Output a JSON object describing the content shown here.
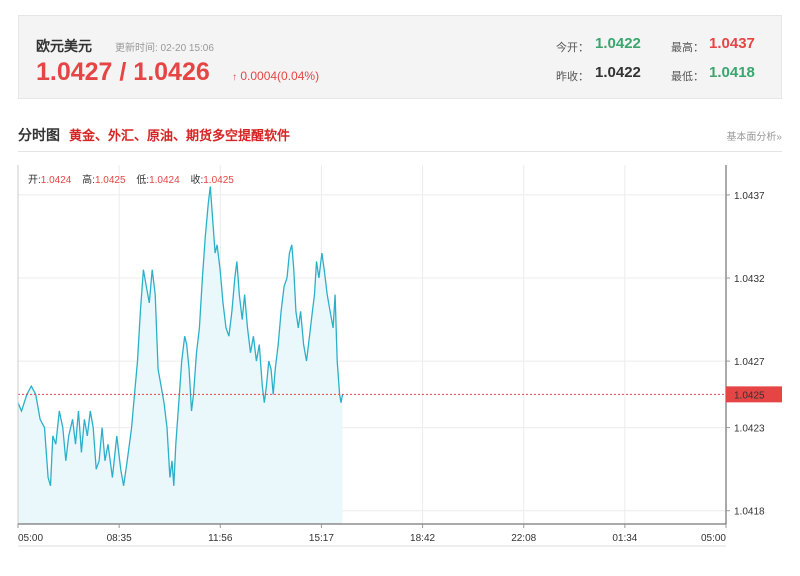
{
  "quote": {
    "name": "欧元美元",
    "update_label": "更新时间: 02-20 15:06",
    "price": "1.0427 / 1.0426",
    "change_arrow": "↑",
    "change": "0.0004(0.04%)",
    "open_label": "今开：",
    "open_value": "1.0422",
    "high_label": "最高：",
    "high_value": "1.0437",
    "prev_close_label": "昨收：",
    "prev_close_value": "1.0422",
    "low_label": "最低：",
    "low_value": "1.0418"
  },
  "tabs": {
    "title": "分时图",
    "promo": "黄金、外汇、原油、期货多空提醒软件",
    "fundamentals": "基本面分析»"
  },
  "colors": {
    "up": "#e64545",
    "down": "#3aa66e",
    "line": "#2bb0c9",
    "fill": "#eaf8fb",
    "current_price_box": "#e64545"
  },
  "chart_data": {
    "type": "area",
    "ohlc": {
      "open_label": "开:",
      "open": "1.0424",
      "high_label": "高:",
      "high": "1.0425",
      "low_label": "低:",
      "low": "1.0424",
      "close_label": "收:",
      "close": "1.0425"
    },
    "x_ticks": [
      "05:00",
      "08:35",
      "11:56",
      "15:17",
      "18:42",
      "22:08",
      "01:34",
      "05:00"
    ],
    "y_ticks": [
      "1.0437",
      "1.0432",
      "1.0427",
      "1.0423",
      "1.0418"
    ],
    "y_tick_values": [
      1.0437,
      1.0432,
      1.0427,
      1.0423,
      1.0418
    ],
    "ylim": [
      1.04172,
      1.04388
    ],
    "current_price": 1.0425,
    "current_price_label": "1.0425",
    "x_unit": "hours since session open (05:00)",
    "points": [
      [
        0.0,
        1.04245
      ],
      [
        0.12,
        1.0424
      ],
      [
        0.3,
        1.0425
      ],
      [
        0.45,
        1.04255
      ],
      [
        0.6,
        1.0425
      ],
      [
        0.75,
        1.04235
      ],
      [
        0.9,
        1.0423
      ],
      [
        1.02,
        1.042
      ],
      [
        1.1,
        1.04195
      ],
      [
        1.18,
        1.04225
      ],
      [
        1.28,
        1.0422
      ],
      [
        1.4,
        1.0424
      ],
      [
        1.52,
        1.0423
      ],
      [
        1.62,
        1.0421
      ],
      [
        1.72,
        1.04225
      ],
      [
        1.85,
        1.04235
      ],
      [
        1.95,
        1.0422
      ],
      [
        2.05,
        1.0424
      ],
      [
        2.15,
        1.04215
      ],
      [
        2.25,
        1.04235
      ],
      [
        2.35,
        1.04225
      ],
      [
        2.45,
        1.0424
      ],
      [
        2.55,
        1.0423
      ],
      [
        2.65,
        1.04205
      ],
      [
        2.75,
        1.0421
      ],
      [
        2.85,
        1.0423
      ],
      [
        2.95,
        1.0421
      ],
      [
        3.05,
        1.0422
      ],
      [
        3.2,
        1.042
      ],
      [
        3.35,
        1.04225
      ],
      [
        3.48,
        1.04205
      ],
      [
        3.58,
        1.04195
      ],
      [
        3.7,
        1.0421
      ],
      [
        3.85,
        1.0423
      ],
      [
        3.95,
        1.0425
      ],
      [
        4.05,
        1.0427
      ],
      [
        4.15,
        1.043
      ],
      [
        4.25,
        1.04325
      ],
      [
        4.35,
        1.04315
      ],
      [
        4.45,
        1.04305
      ],
      [
        4.55,
        1.04325
      ],
      [
        4.65,
        1.0431
      ],
      [
        4.75,
        1.04265
      ],
      [
        4.85,
        1.04255
      ],
      [
        4.95,
        1.04245
      ],
      [
        5.05,
        1.0423
      ],
      [
        5.15,
        1.042
      ],
      [
        5.22,
        1.0421
      ],
      [
        5.28,
        1.04195
      ],
      [
        5.35,
        1.0422
      ],
      [
        5.45,
        1.04245
      ],
      [
        5.55,
        1.0427
      ],
      [
        5.65,
        1.04285
      ],
      [
        5.72,
        1.0428
      ],
      [
        5.8,
        1.04265
      ],
      [
        5.88,
        1.0424
      ],
      [
        5.95,
        1.0425
      ],
      [
        6.05,
        1.04275
      ],
      [
        6.15,
        1.0429
      ],
      [
        6.25,
        1.0432
      ],
      [
        6.35,
        1.04345
      ],
      [
        6.45,
        1.04365
      ],
      [
        6.52,
        1.04375
      ],
      [
        6.6,
        1.04355
      ],
      [
        6.68,
        1.04335
      ],
      [
        6.75,
        1.0434
      ],
      [
        6.85,
        1.04325
      ],
      [
        6.95,
        1.04305
      ],
      [
        7.05,
        1.0429
      ],
      [
        7.15,
        1.04285
      ],
      [
        7.25,
        1.043
      ],
      [
        7.35,
        1.0432
      ],
      [
        7.42,
        1.0433
      ],
      [
        7.5,
        1.0431
      ],
      [
        7.6,
        1.04295
      ],
      [
        7.68,
        1.0431
      ],
      [
        7.78,
        1.0429
      ],
      [
        7.88,
        1.04275
      ],
      [
        7.98,
        1.04285
      ],
      [
        8.08,
        1.0427
      ],
      [
        8.18,
        1.0428
      ],
      [
        8.28,
        1.04255
      ],
      [
        8.35,
        1.04245
      ],
      [
        8.42,
        1.04255
      ],
      [
        8.5,
        1.0427
      ],
      [
        8.58,
        1.04265
      ],
      [
        8.65,
        1.0425
      ],
      [
        8.72,
        1.04265
      ],
      [
        8.82,
        1.0428
      ],
      [
        8.92,
        1.043
      ],
      [
        9.02,
        1.04315
      ],
      [
        9.12,
        1.0432
      ],
      [
        9.2,
        1.04335
      ],
      [
        9.28,
        1.0434
      ],
      [
        9.35,
        1.04325
      ],
      [
        9.42,
        1.043
      ],
      [
        9.5,
        1.0429
      ],
      [
        9.58,
        1.043
      ],
      [
        9.68,
        1.0428
      ],
      [
        9.78,
        1.0427
      ],
      [
        9.88,
        1.04285
      ],
      [
        9.98,
        1.043
      ],
      [
        10.05,
        1.0431
      ],
      [
        10.12,
        1.0433
      ],
      [
        10.2,
        1.0432
      ],
      [
        10.3,
        1.04335
      ],
      [
        10.38,
        1.04325
      ],
      [
        10.48,
        1.0431
      ],
      [
        10.58,
        1.043
      ],
      [
        10.68,
        1.0429
      ],
      [
        10.75,
        1.0431
      ],
      [
        10.82,
        1.0427
      ],
      [
        10.9,
        1.0425
      ],
      [
        10.95,
        1.04245
      ],
      [
        11.0,
        1.0425
      ]
    ]
  }
}
